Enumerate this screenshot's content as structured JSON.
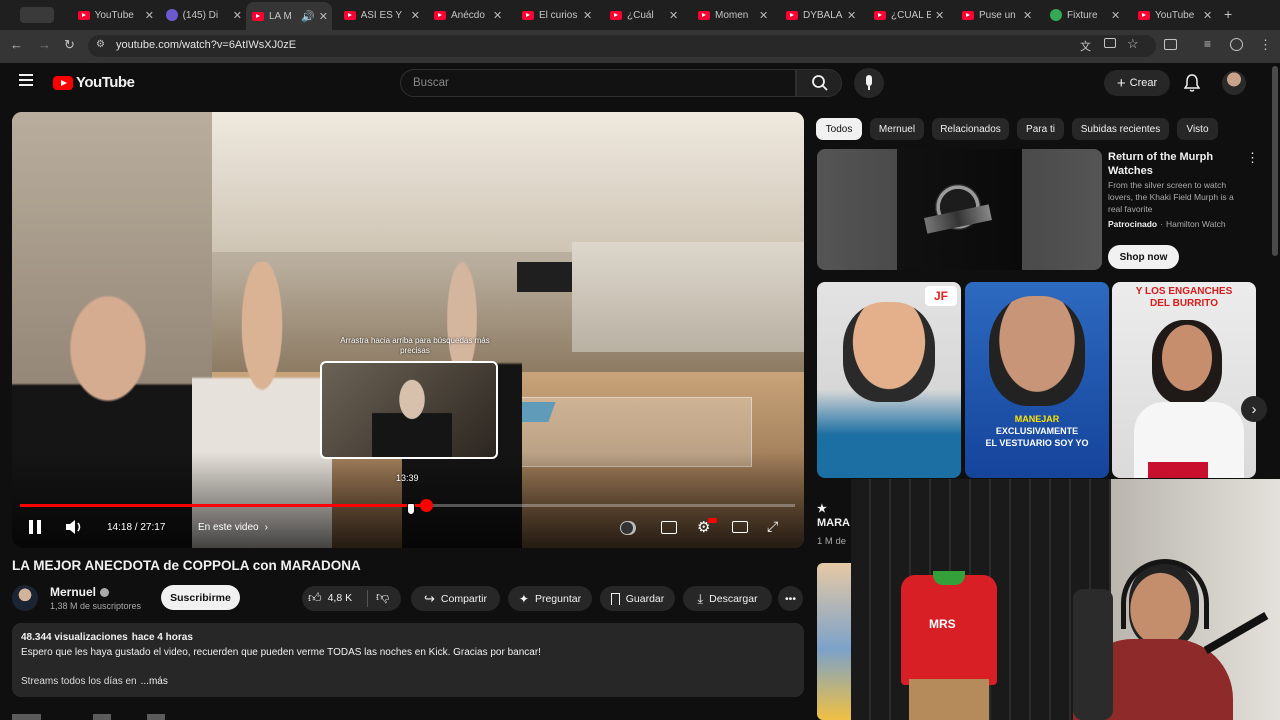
{
  "browser": {
    "tabs": [
      {
        "label": "YouTube",
        "active": false
      },
      {
        "label": "(145) Di",
        "active": false
      },
      {
        "label": "LA M",
        "active": true
      },
      {
        "label": "ASÍ ES Y",
        "active": false
      },
      {
        "label": "Anécdo",
        "active": false
      },
      {
        "label": "El curios",
        "active": false
      },
      {
        "label": "¿Cuál",
        "active": false
      },
      {
        "label": "Momen",
        "active": false
      },
      {
        "label": "DYBALA",
        "active": false
      },
      {
        "label": "¿CUÁL E",
        "active": false
      },
      {
        "label": "Puse un",
        "active": false
      },
      {
        "label": "Fixture",
        "active": false
      },
      {
        "label": "YouTube",
        "active": false
      }
    ],
    "url": "youtube.com/watch?v=6AtIWsXJ0zE",
    "tab_badge": "145"
  },
  "youtube": {
    "logo_text": "YouTube",
    "search_placeholder": "Buscar",
    "create_label": "Crear"
  },
  "player": {
    "current_time": "14:18",
    "duration": "27:17",
    "time_display": "14:18 / 27:17",
    "progress_fraction": 0.524,
    "hover_time": "13:39",
    "hover_fraction": 0.5,
    "in_video_label": "En este video",
    "drag_hint": "Arrastra hacia arriba para búsquedas más precisas",
    "accent_color": "#ff0000"
  },
  "video": {
    "title": "LA MEJOR ANECDOTA de COPPOLA con MARADONA",
    "channel": "Mernuel",
    "subscribers": "1,38 M de suscriptores",
    "subscribe_label": "Suscribirme",
    "likes": "4,8 K",
    "share_label": "Compartir",
    "ask_label": "Preguntar",
    "save_label": "Guardar",
    "download_label": "Descargar",
    "views": "48.344 visualizaciones",
    "uploaded": "hace 4 horas",
    "description_line1": "Espero que les haya gustado el video, recuerden que pueden verme TODAS las noches en Kick. Gracias por bancar!",
    "description_line2": "Streams todos los días en",
    "more_label": "...más"
  },
  "chips": [
    "Todos",
    "Mernuel",
    "Relacionados",
    "Para ti",
    "Subidas recientes",
    "Visto"
  ],
  "ad": {
    "title": "Return of the Murph Watches",
    "body": "From the silver screen to watch lovers, the Khaki Field Murph is a real favorite",
    "sponsored": "Patrocinado",
    "advertiser": "Hamilton Watch",
    "cta": "Shop now"
  },
  "shelf": {
    "thumb2_caption_1": "MANEJAR",
    "thumb2_caption_2": "EXCLUSIVAMENTE",
    "thumb2_caption_3": "EL VESTUARIO SOY YO",
    "thumb3_caption_1": "Y LOS ENGANCHES",
    "thumb3_caption_2": "DEL BURRITO",
    "partial_title": "MARA",
    "partial_meta": "1 M de"
  },
  "webcam": {
    "shirt_text": "MRS"
  }
}
